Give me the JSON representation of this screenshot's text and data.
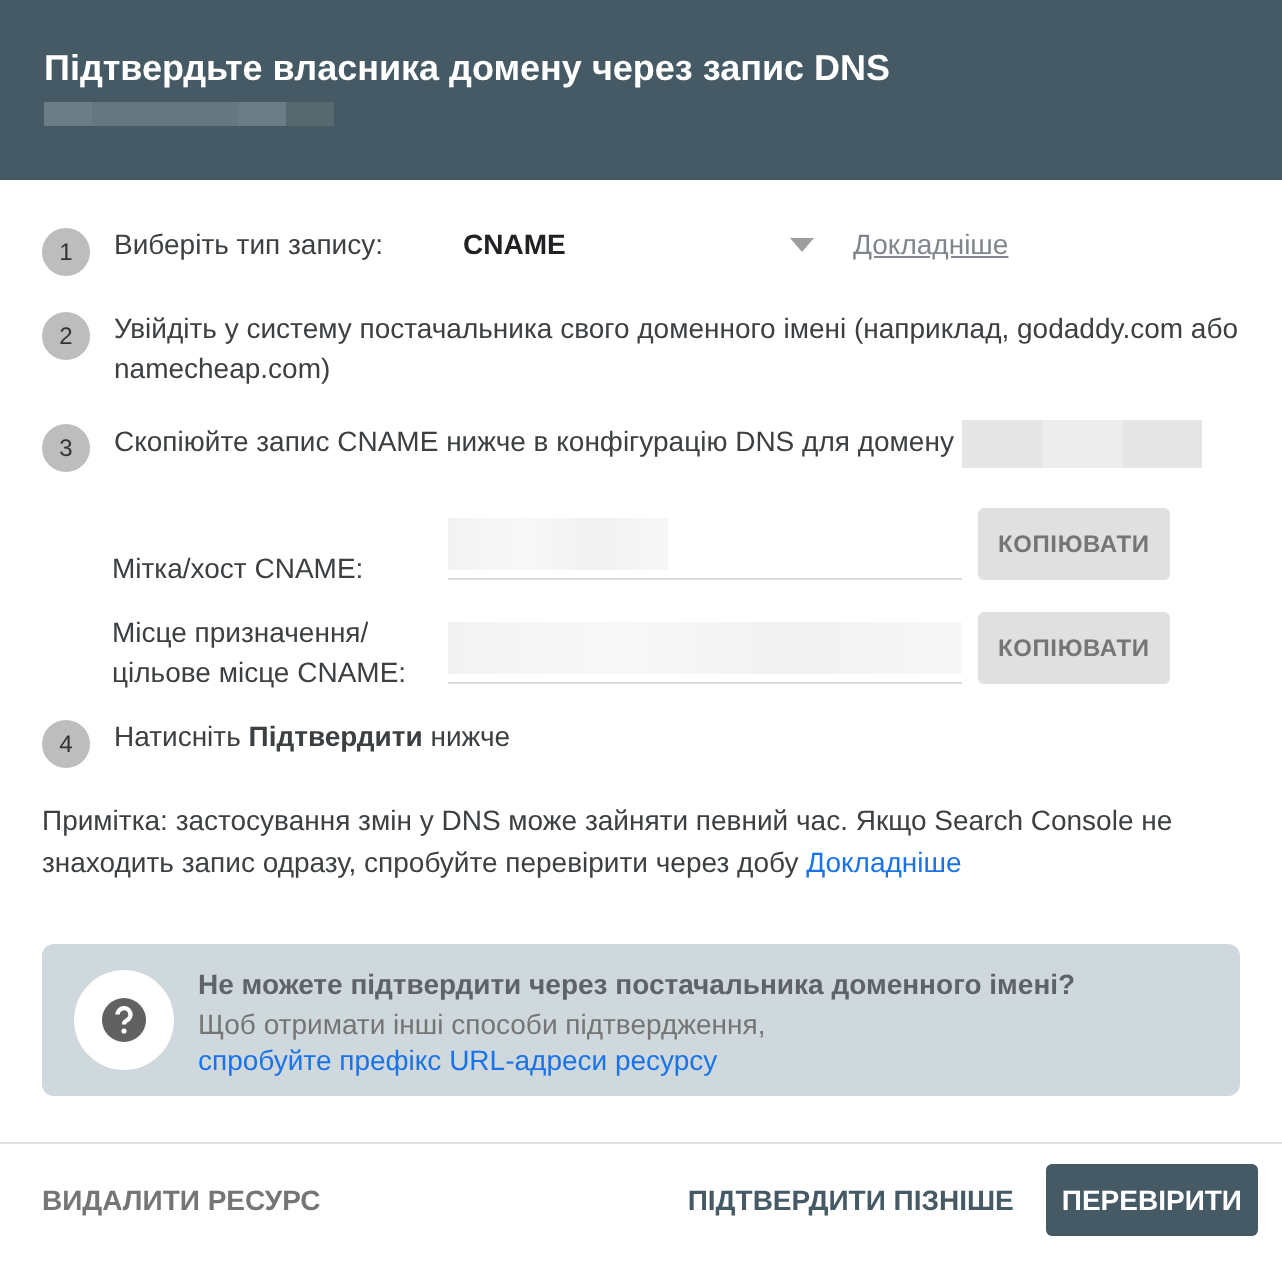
{
  "dialog": {
    "title": "Підтвердьте власника домену через запис DNS"
  },
  "steps": [
    {
      "number": "1",
      "kind": "select",
      "text": "Виберіть тип запису:",
      "select_value": "CNAME",
      "link": "Докладніше"
    },
    {
      "number": "2",
      "kind": "text",
      "text": "Увійдіть у систему постачальника свого доменного імені (наприклад, godaddy.com або namecheap.com)"
    },
    {
      "number": "3",
      "kind": "domain",
      "text": "Скопіюйте запис CNAME нижче в конфігурацію DNS для домену"
    },
    {
      "number": "4",
      "kind": "text",
      "text": "Натисніть **Підтвердити** нижче"
    }
  ],
  "record_fields": [
    {
      "label": "Мітка/хост CNAME:",
      "button": "КОПІЮВАТИ"
    },
    {
      "label": "Місце призначення/ цільове місце CNAME:",
      "button": "КОПІЮВАТИ"
    }
  ],
  "note": {
    "text": "Примітка: застосування змін у DNS може зайняти певний час. Якщо Search Console не знаходить запис одразу, спробуйте перевірити через добу",
    "link": "Докладніше"
  },
  "info_box": {
    "title": "Не можете підтвердити через постачальника доменного імені?",
    "text": "Щоб отримати інші способи підтвердження,",
    "link": "спробуйте префікс URL-адреси ресурсу"
  },
  "footer": {
    "left_button": "ВИДАЛИТИ РЕСУРС",
    "later_button": "ПІДТВЕРДИТИ ПІЗНІШЕ",
    "primary_button": "ПЕРЕВІРИТИ"
  }
}
